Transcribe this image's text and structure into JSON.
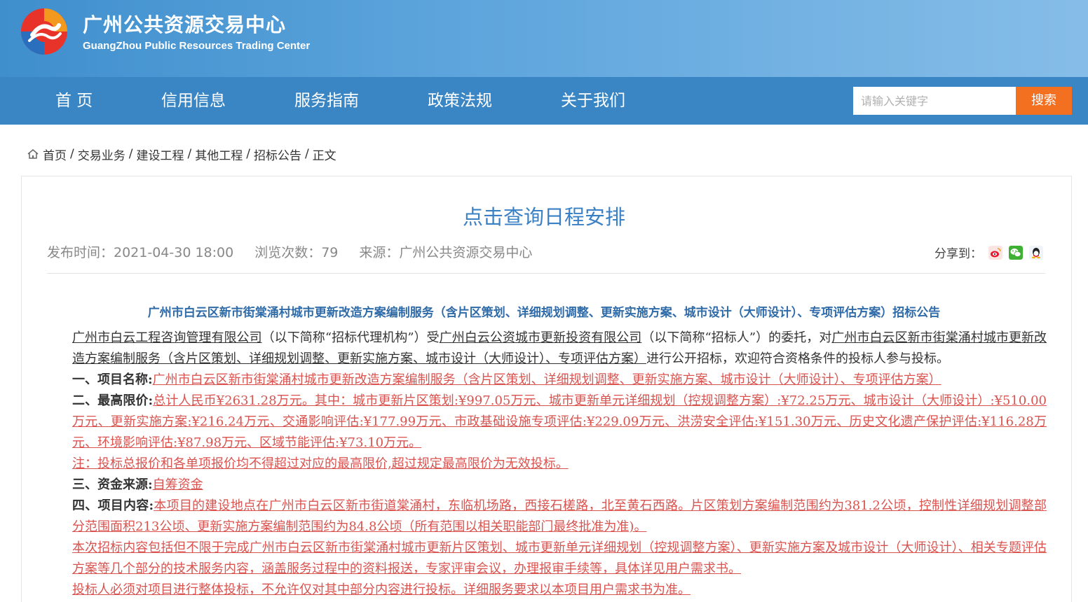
{
  "header": {
    "title": "广州公共资源交易中心",
    "subtitle": "GuangZhou Public Resources Trading Center"
  },
  "nav": {
    "items": [
      "首 页",
      "信用信息",
      "服务指南",
      "政策法规",
      "关于我们"
    ]
  },
  "search": {
    "placeholder": "请输入关键字",
    "button_label": "搜索"
  },
  "breadcrumb": [
    "首页",
    "交易业务",
    "建设工程",
    "其他工程",
    "招标公告",
    "正文"
  ],
  "article": {
    "schedule_link": "点击查询日程安排",
    "publish_time": "发布时间：2021-04-30 18:00",
    "views": "浏览次数：79",
    "source": "来源：广州公共资源交易中心",
    "share_label": "分享到：",
    "share_icons": [
      "weibo-icon",
      "wechat-icon",
      "qq-icon"
    ],
    "title": "广州市白云区新市街棠涌村城市更新改造方案编制服务（含片区策划、详细规划调整、更新实施方案、城市设计（大师设计）、专项评估方案）招标公告",
    "intro": {
      "agency": "广州市白云工程咨询管理有限公司",
      "t1": "（以下简称“招标代理机构”）受",
      "tenderer": "广州白云公资城市更新投资有限公司",
      "t2": "（以下简称“招标人”）的委托，对",
      "project": "广州市白云区新市街棠涌村城市更新改造方案编制服务（含片区策划、详细规划调整、更新实施方案、城市设计（大师设计）、专项评估方案）",
      "t3": "进行公开招标，欢迎符合资格条件的投标人参与投标。"
    },
    "s1_label": "一、项目名称:",
    "s1_value": "广州市白云区新市街棠涌村城市更新改造方案编制服务（含片区策划、详细规划调整、更新实施方案、城市设计（大师设计）、专项评估方案）",
    "s2_label": "二、最高限价:",
    "s2_value": "总计人民币¥2631.28万元。其中：城市更新片区策划:¥997.05万元、城市更新单元详细规划（控规调整方案）:¥72.25万元、城市设计（大师设计）:¥510.00万元、更新实施方案:¥216.24万元、交通影响评估:¥177.99万元、市政基础设施专项评估:¥229.09万元、洪涝安全评估:¥151.30万元、历史文化遗产保护评估:¥116.28万元、环境影响评估:¥87.98万元、区域节能评估:¥73.10万元。",
    "s2_note": "注：投标总报价和各单项报价均不得超过对应的最高限价,超过规定最高限价为无效投标。",
    "s3_label": "三、资金来源:",
    "s3_value": "自筹资金",
    "s4_label": "四、项目内容:",
    "s4_value": "本项目的建设地点在广州市白云区新市街道棠涌村，东临机场路，西接石槎路，北至黄石西路。片区策划方案编制范围约为381.2公顷，控制性详细规划调整部分范围面积213公顷、更新实施方案编制范围约为84.8公顷（所有范围以相关职能部门最终批准为准)。",
    "s4_p2": "本次招标内容包括但不限于完成广州市白云区新市街棠涌村城市更新片区策划、城市更新单元详细规划（控规调整方案）、更新实施方案及城市设计（大师设计）、相关专题评估方案等几个部分的技术服务内容，涵盖服务过程中的资料报送，专家评审会议，办理报审手续等，具体详见用户需求书。",
    "s4_p3": "投标人必须对项目进行整体投标，不允许仅对其中部分内容进行投标。详细服务要求以本项目用户需求书为准。"
  }
}
